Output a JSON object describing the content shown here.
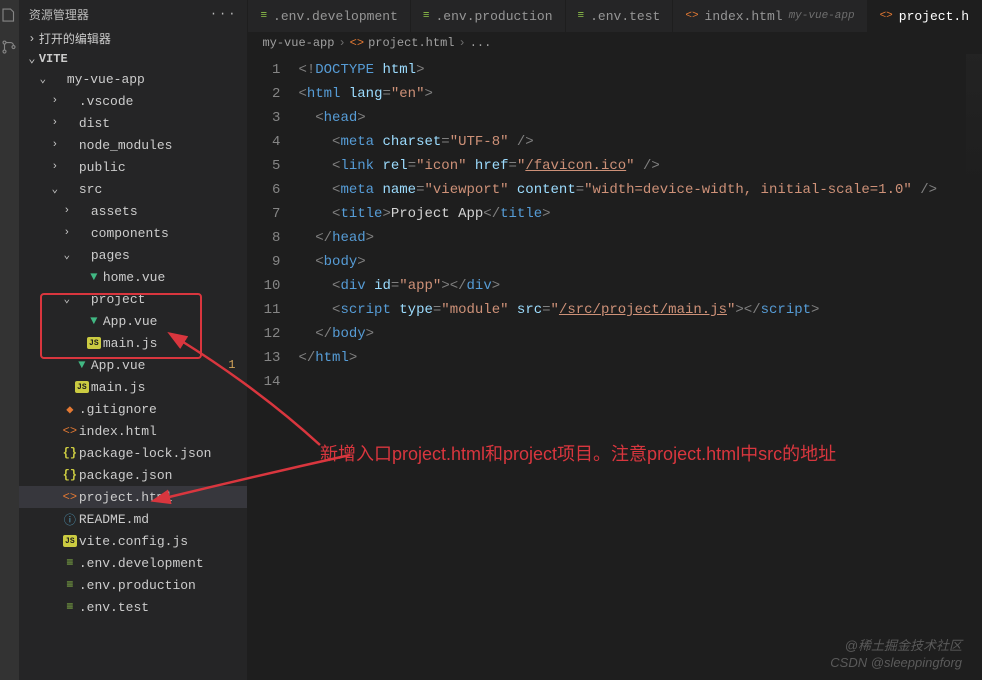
{
  "sidebar": {
    "title": "资源管理器",
    "sections": {
      "editors": "打开的编辑器",
      "workspace": "VITE"
    },
    "tree": [
      {
        "depth": 1,
        "arrow": "v",
        "icon": "",
        "label": "my-vue-app",
        "cls": "clr-root"
      },
      {
        "depth": 2,
        "arrow": ">",
        "icon": "",
        "label": ".vscode",
        "cls": "clr-folder"
      },
      {
        "depth": 2,
        "arrow": ">",
        "icon": "",
        "label": "dist",
        "cls": "clr-folder"
      },
      {
        "depth": 2,
        "arrow": ">",
        "icon": "",
        "label": "node_modules",
        "cls": "clr-folder"
      },
      {
        "depth": 2,
        "arrow": ">",
        "icon": "",
        "label": "public",
        "cls": "clr-folder"
      },
      {
        "depth": 2,
        "arrow": "v",
        "icon": "",
        "label": "src",
        "cls": "clr-src"
      },
      {
        "depth": 3,
        "arrow": ">",
        "icon": "",
        "label": "assets",
        "cls": "clr-folder"
      },
      {
        "depth": 3,
        "arrow": ">",
        "icon": "",
        "label": "components",
        "cls": "clr-comp"
      },
      {
        "depth": 3,
        "arrow": "v",
        "icon": "",
        "label": "pages",
        "cls": "clr-folder"
      },
      {
        "depth": 4,
        "arrow": "",
        "icon": "vue",
        "label": "home.vue",
        "cls": "clr-folder"
      },
      {
        "depth": 3,
        "arrow": "v",
        "icon": "",
        "label": "project",
        "cls": "clr-folder"
      },
      {
        "depth": 4,
        "arrow": "",
        "icon": "vue",
        "label": "App.vue",
        "cls": "clr-folder"
      },
      {
        "depth": 4,
        "arrow": "",
        "icon": "js",
        "label": "main.js",
        "cls": "clr-folder"
      },
      {
        "depth": 3,
        "arrow": "",
        "icon": "vue",
        "label": "App.vue",
        "cls": "clr-app-mod",
        "badge": "1"
      },
      {
        "depth": 3,
        "arrow": "",
        "icon": "js",
        "label": "main.js",
        "cls": "clr-folder"
      },
      {
        "depth": 2,
        "arrow": "",
        "icon": "git",
        "label": ".gitignore",
        "cls": "clr-folder"
      },
      {
        "depth": 2,
        "arrow": "",
        "icon": "html",
        "label": "index.html",
        "cls": "clr-folder"
      },
      {
        "depth": 2,
        "arrow": "",
        "icon": "json",
        "label": "package-lock.json",
        "cls": "clr-folder"
      },
      {
        "depth": 2,
        "arrow": "",
        "icon": "json",
        "label": "package.json",
        "cls": "clr-folder"
      },
      {
        "depth": 2,
        "arrow": "",
        "icon": "html",
        "label": "project.html",
        "cls": "clr-folder",
        "selected": true
      },
      {
        "depth": 2,
        "arrow": "",
        "icon": "info",
        "label": "README.md",
        "cls": "clr-folder"
      },
      {
        "depth": 2,
        "arrow": "",
        "icon": "js",
        "label": "vite.config.js",
        "cls": "clr-folder"
      },
      {
        "depth": 2,
        "arrow": "",
        "icon": "env",
        "label": ".env.development",
        "cls": "clr-folder"
      },
      {
        "depth": 2,
        "arrow": "",
        "icon": "env",
        "label": ".env.production",
        "cls": "clr-folder"
      },
      {
        "depth": 2,
        "arrow": "",
        "icon": "env",
        "label": ".env.test",
        "cls": "clr-folder"
      }
    ]
  },
  "tabs": [
    {
      "icon": "env",
      "label": ".env.development"
    },
    {
      "icon": "env",
      "label": ".env.production"
    },
    {
      "icon": "env",
      "label": ".env.test"
    },
    {
      "icon": "html",
      "label": "index.html",
      "sub": "my-vue-app"
    },
    {
      "icon": "html",
      "label": "project.h",
      "active": true
    }
  ],
  "breadcrumb": {
    "root": "my-vue-app",
    "file": "project.html",
    "more": "..."
  },
  "code_lines": [
    {
      "n": 1,
      "html": "<span class='c-punc'>&lt;!</span><span class='c-doctype'>DOCTYPE</span> <span class='c-attr'>html</span><span class='c-punc'>&gt;</span>"
    },
    {
      "n": 2,
      "html": "<span class='c-punc'>&lt;</span><span class='c-tag'>html</span> <span class='c-attr'>lang</span><span class='c-punc'>=</span><span class='c-str'>\"en\"</span><span class='c-punc'>&gt;</span>"
    },
    {
      "n": 3,
      "html": "  <span class='c-punc'>&lt;</span><span class='c-tag'>head</span><span class='c-punc'>&gt;</span>"
    },
    {
      "n": 4,
      "html": "    <span class='c-punc'>&lt;</span><span class='c-tag'>meta</span> <span class='c-attr'>charset</span><span class='c-punc'>=</span><span class='c-str'>\"UTF-8\"</span> <span class='c-punc'>/&gt;</span>"
    },
    {
      "n": 5,
      "html": "    <span class='c-punc'>&lt;</span><span class='c-tag'>link</span> <span class='c-attr'>rel</span><span class='c-punc'>=</span><span class='c-str'>\"icon\"</span> <span class='c-attr'>href</span><span class='c-punc'>=</span><span class='c-str'>\"</span><span class='c-link'>/favicon.ico</span><span class='c-str'>\"</span> <span class='c-punc'>/&gt;</span>"
    },
    {
      "n": 6,
      "html": "    <span class='c-punc'>&lt;</span><span class='c-tag'>meta</span> <span class='c-attr'>name</span><span class='c-punc'>=</span><span class='c-str'>\"viewport\"</span> <span class='c-attr'>content</span><span class='c-punc'>=</span><span class='c-str'>\"width=device-width, initial-scale=1.0\"</span> <span class='c-punc'>/&gt;</span>"
    },
    {
      "n": 7,
      "html": "    <span class='c-punc'>&lt;</span><span class='c-tag'>title</span><span class='c-punc'>&gt;</span><span class='c-txt'>Project App</span><span class='c-punc'>&lt;/</span><span class='c-tag'>title</span><span class='c-punc'>&gt;</span>"
    },
    {
      "n": 8,
      "html": "  <span class='c-punc'>&lt;/</span><span class='c-tag'>head</span><span class='c-punc'>&gt;</span>"
    },
    {
      "n": 9,
      "html": "  <span class='c-punc'>&lt;</span><span class='c-tag'>body</span><span class='c-punc'>&gt;</span>"
    },
    {
      "n": 10,
      "html": "    <span class='c-punc'>&lt;</span><span class='c-tag'>div</span> <span class='c-attr'>id</span><span class='c-punc'>=</span><span class='c-str'>\"app\"</span><span class='c-punc'>&gt;&lt;/</span><span class='c-tag'>div</span><span class='c-punc'>&gt;</span>"
    },
    {
      "n": 11,
      "html": "    <span class='c-punc'>&lt;</span><span class='c-tag'>script</span> <span class='c-attr'>type</span><span class='c-punc'>=</span><span class='c-str'>\"module\"</span> <span class='c-attr'>src</span><span class='c-punc'>=</span><span class='c-str'>\"</span><span class='c-link'>/src/project/main.js</span><span class='c-str'>\"</span><span class='c-punc'>&gt;&lt;/</span><span class='c-tag'>script</span><span class='c-punc'>&gt;</span>"
    },
    {
      "n": 12,
      "html": "  <span class='c-punc'>&lt;/</span><span class='c-tag'>body</span><span class='c-punc'>&gt;</span>"
    },
    {
      "n": 13,
      "html": "<span class='c-punc'>&lt;/</span><span class='c-tag'>html</span><span class='c-punc'>&gt;</span>"
    },
    {
      "n": 14,
      "html": ""
    }
  ],
  "annotation": "新增入口project.html和project项目。注意project.html中src的地址",
  "watermark": {
    "line1": "@稀土掘金技术社区",
    "line2": "CSDN @sleeppingforg"
  }
}
